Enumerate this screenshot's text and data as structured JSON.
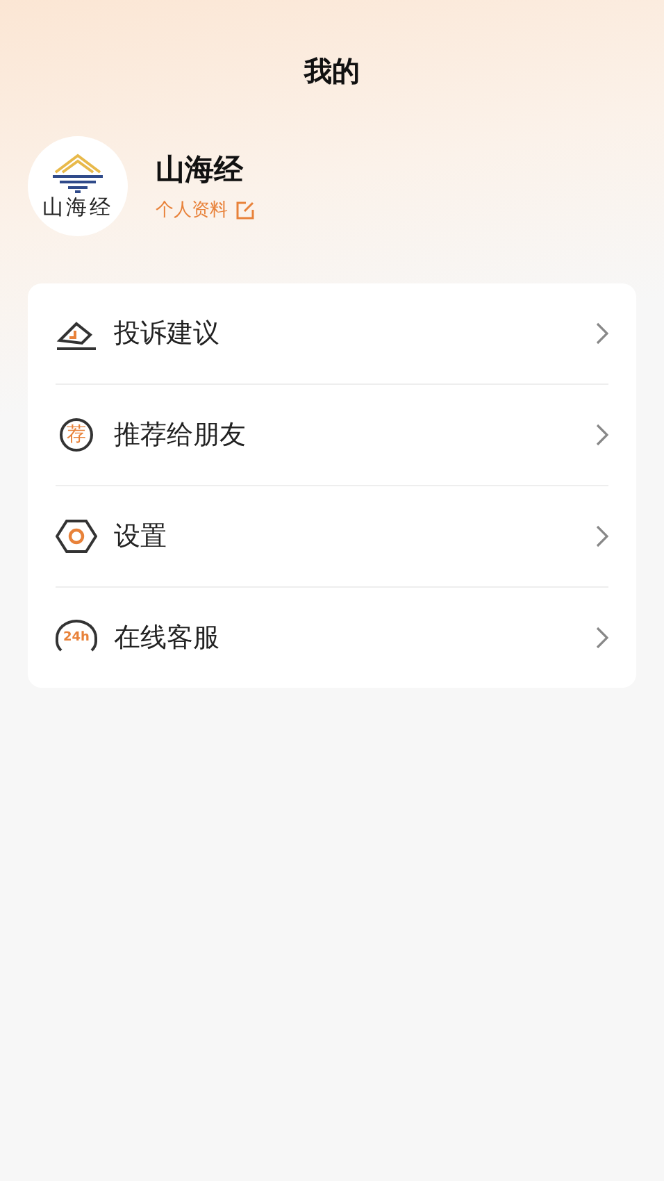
{
  "title": "我的",
  "profile": {
    "avatar_text": "山海经",
    "name": "山海经",
    "edit_link": "个人资料"
  },
  "menu": [
    {
      "kind": "feedback",
      "label": "投诉建议"
    },
    {
      "kind": "recommend",
      "label": "推荐给朋友",
      "icon_text": "荐"
    },
    {
      "kind": "settings",
      "label": "设置"
    },
    {
      "kind": "service",
      "label": "在线客服",
      "icon_text": "24h"
    }
  ]
}
